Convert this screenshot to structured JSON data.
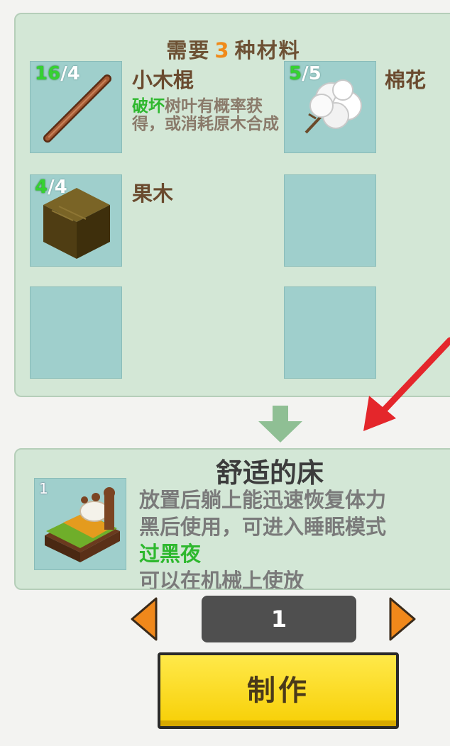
{
  "requirements": {
    "prefix": "需要",
    "count": "3",
    "suffix": "种材料"
  },
  "materials": [
    {
      "have": "16",
      "sep": "/",
      "need": "4",
      "name": "小木棍",
      "desc_hl": "破坏",
      "desc": "树叶有概率获得，或消耗原木合成",
      "icon": "stick-icon"
    },
    {
      "have": "5",
      "sep": "/",
      "need": "5",
      "name": "棉花",
      "icon": "cotton-icon"
    },
    {
      "have": "4",
      "sep": "/",
      "need": "4",
      "name": "果木",
      "icon": "fruitwood-block-icon"
    }
  ],
  "result": {
    "qty": "1",
    "name": "舒适的床",
    "desc_line1": "放置后躺上能迅速恢复体力",
    "desc_line2": "黑后使用，可进入睡眠模式",
    "desc_hl": "过黑夜",
    "desc_line4": "可以在机械上使放",
    "icon": "bed-icon"
  },
  "quantity": {
    "value": "1"
  },
  "craft_button": {
    "label": "制作"
  },
  "colors": {
    "panel_bg": "#d3e7d6",
    "slot_bg": "#9fcfcc",
    "have_green": "#36d132",
    "highlight_green": "#2eb82e",
    "orange": "#f08a1a",
    "craft_yellow": "#f7cf05"
  }
}
